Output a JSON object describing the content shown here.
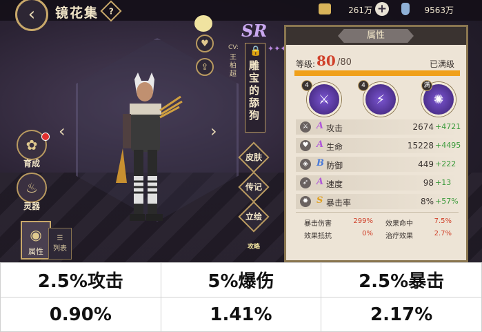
{
  "header": {
    "title": "镜花集",
    "help_symbol": "?",
    "currency1_value": "261万",
    "currency2_value": "9563万"
  },
  "left_menu": {
    "items": [
      {
        "label": "育成",
        "icon": "flower-icon"
      },
      {
        "label": "灵器",
        "icon": "fan-icon"
      }
    ],
    "tabs": [
      {
        "label": "属性"
      },
      {
        "label": "列表"
      }
    ]
  },
  "character": {
    "rarity": "SR",
    "cv_label": "CV:",
    "cv_name": "王柏超",
    "name": "雕宝的舔狗",
    "side_tabs": [
      "皮肤",
      "传记",
      "立绘"
    ],
    "chibi_label": "攻略"
  },
  "panel": {
    "title": "属性",
    "level_label": "等级:",
    "level_value": "80",
    "level_max": "/80",
    "level_status": "已满级",
    "level_progress": 1.0,
    "skills": [
      {
        "badge": "4",
        "icon": "dash-skill-icon"
      },
      {
        "badge": "4",
        "icon": "slash-skill-icon"
      },
      {
        "badge": "满",
        "icon": "burst-skill-icon"
      }
    ],
    "stats": [
      {
        "grade": "A",
        "grade_color": "#b05ad8",
        "name": "攻击",
        "value": "2674",
        "bonus": "+4721",
        "icon": "sword-icon"
      },
      {
        "grade": "A",
        "grade_color": "#b05ad8",
        "name": "生命",
        "value": "15228",
        "bonus": "+4495",
        "icon": "heart-icon"
      },
      {
        "grade": "B",
        "grade_color": "#4a7ad8",
        "name": "防御",
        "value": "449",
        "bonus": "+222",
        "icon": "shield-icon"
      },
      {
        "grade": "A",
        "grade_color": "#b05ad8",
        "name": "速度",
        "value": "98",
        "bonus": "+13",
        "icon": "boot-icon"
      },
      {
        "grade": "S",
        "grade_color": "#e0a020",
        "name": "暴击率",
        "value": "8%",
        "bonus": "+57%",
        "icon": "crit-icon"
      }
    ],
    "sub_stats": [
      {
        "name": "暴击伤害",
        "value": "299%"
      },
      {
        "name": "效果命中",
        "value": "7.5%"
      },
      {
        "name": "效果抵抗",
        "value": "0%"
      },
      {
        "name": "治疗效果",
        "value": "2.7%"
      }
    ]
  },
  "table": {
    "headers": [
      "2.5%攻击",
      "5%爆伤",
      "2.5%暴击"
    ],
    "values": [
      "0.90%",
      "1.41%",
      "2.17%"
    ]
  }
}
